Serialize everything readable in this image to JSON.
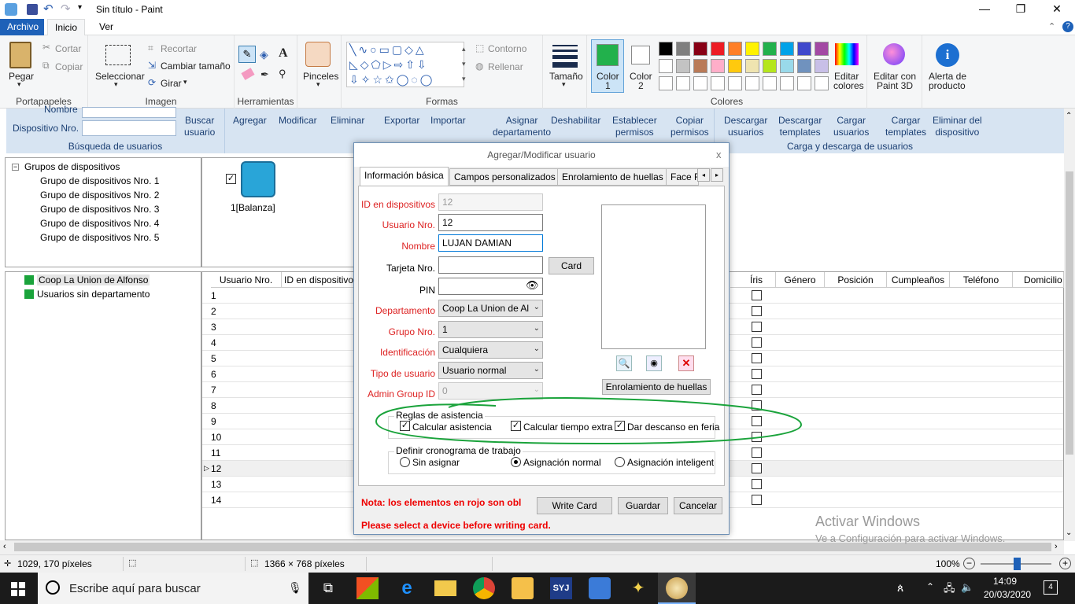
{
  "paint": {
    "title": "Sin título - Paint",
    "tabs": [
      "Archivo",
      "Inicio",
      "Ver"
    ],
    "clipboard": {
      "paste": "Pegar",
      "cut": "Cortar",
      "copy": "Copiar",
      "group": "Portapapeles"
    },
    "image": {
      "select": "Seleccionar",
      "crop": "Recortar",
      "resize": "Cambiar tamaño",
      "rotate": "Girar",
      "group": "Imagen"
    },
    "tools": {
      "group": "Herramientas"
    },
    "brushes": {
      "label": "Pinceles"
    },
    "shapes": {
      "outline": "Contorno",
      "fill": "Rellenar",
      "group": "Formas"
    },
    "size": {
      "label": "Tamaño"
    },
    "color1": {
      "label": "Color",
      "sub": "1"
    },
    "color2": {
      "label": "Color",
      "sub": "2"
    },
    "colors": {
      "group": "Colores",
      "edit": "Editar",
      "edit2": "colores"
    },
    "paint3d": {
      "l1": "Editar con",
      "l2": "Paint 3D"
    },
    "alert": {
      "l1": "Alerta de",
      "l2": "producto"
    },
    "palette_row1": [
      "#000000",
      "#7f7f7f",
      "#880015",
      "#ed1c24",
      "#ff7f27",
      "#fff200",
      "#22b14c",
      "#00a2e8",
      "#3f48cc",
      "#a349a4"
    ],
    "palette_row2": [
      "#ffffff",
      "#c3c3c3",
      "#b97a57",
      "#ffaec9",
      "#ffc90e",
      "#efe4b0",
      "#b5e61d",
      "#99d9ea",
      "#7092be",
      "#c8bfe7"
    ],
    "color1_value": "#22b14c"
  },
  "app": {
    "search": {
      "name_label": "Nombre",
      "device_label": "Dispositivo Nro.",
      "search_btn_l1": "Buscar",
      "search_btn_l2": "usuario",
      "caption": "Búsqueda de usuarios"
    },
    "buttons": [
      {
        "l1": "Agregar",
        "l2": ""
      },
      {
        "l1": "Modificar",
        "l2": ""
      },
      {
        "l1": "Eliminar",
        "l2": ""
      },
      {
        "l1": "Exportar",
        "l2": ""
      },
      {
        "l1": "Importar",
        "l2": ""
      },
      {
        "l1": "Asignar",
        "l2": "departamento"
      },
      {
        "l1": "Deshabilitar",
        "l2": ""
      },
      {
        "l1": "Establecer",
        "l2": "permisos"
      },
      {
        "l1": "Copiar",
        "l2": "permisos"
      }
    ],
    "downloads": [
      {
        "l1": "Descargar",
        "l2": "usuarios"
      },
      {
        "l1": "Descargar",
        "l2": "templates"
      },
      {
        "l1": "Cargar",
        "l2": "usuarios"
      },
      {
        "l1": "Cargar",
        "l2": "templates"
      },
      {
        "l1": "Eliminar del",
        "l2": "dispositivo"
      }
    ],
    "downloads_caption": "Carga y descarga de usuarios",
    "device_tree": {
      "root": "Grupos de dispositivos",
      "items": [
        "Grupo de dispositivos Nro. 1",
        "Grupo de dispositivos Nro. 2",
        "Grupo de dispositivos Nro. 3",
        "Grupo de dispositivos Nro. 4",
        "Grupo de dispositivos Nro. 5"
      ]
    },
    "device_icon_label": "1[Balanza]",
    "dept_tree": [
      "Coop La Union de Alfonso",
      "Usuarios sin departamento"
    ],
    "grid_headers_left": [
      "Usuario Nro.",
      "ID en dispositivo"
    ],
    "grid_headers_right": [
      "Íris",
      "Género",
      "Posición",
      "Cumpleaños",
      "Teléfono",
      "Domicilio"
    ],
    "rows": [
      "1",
      "2",
      "3",
      "4",
      "5",
      "6",
      "7",
      "8",
      "9",
      "10",
      "11",
      "12",
      "13",
      "14"
    ],
    "selected_row": "12"
  },
  "dialog": {
    "title": "Agregar/Modificar usuario",
    "close": "x",
    "tabs": [
      "Información básica",
      "Campos personalizados",
      "Enrolamiento de huellas",
      "Face F"
    ],
    "fields": {
      "device_id": {
        "label": "ID en dispositivos",
        "value": "12"
      },
      "user_no": {
        "label": "Usuario Nro.",
        "value": "12"
      },
      "name": {
        "label": "Nombre",
        "value": "LUJAN DAMIAN"
      },
      "card": {
        "label": "Tarjeta Nro.",
        "value": ""
      },
      "pin": {
        "label": "PIN",
        "value": ""
      },
      "department": {
        "label": "Departamento",
        "value": "Coop La Union de Al"
      },
      "group": {
        "label": "Grupo Nro.",
        "value": "1"
      },
      "identification": {
        "label": "Identificación",
        "value": "Cualquiera"
      },
      "user_type": {
        "label": "Tipo de usuario",
        "value": "Usuario normal"
      },
      "admin_group": {
        "label": "Admin Group ID",
        "value": "0"
      }
    },
    "card_button": "Card",
    "enroll_button": "Enrolamiento de huellas",
    "attendance": {
      "legend": "Reglas de asistencia",
      "calc": "Calcular asistencia",
      "extra": "Calcular tiempo extra",
      "rest": "Dar descanso en feria"
    },
    "schedule": {
      "legend": "Definir cronograma de trabajo",
      "none": "Sin asignar",
      "normal": "Asignación normal",
      "smart": "Asignación inteligent"
    },
    "note": "Nota: los elementos en rojo son obl",
    "warning": "Please select a device before writing card.",
    "write_card": "Write Card",
    "save": "Guardar",
    "cancel": "Cancelar"
  },
  "watermark": {
    "l1": "Activar Windows",
    "l2": "Ve a Configuración para activar Windows."
  },
  "status": {
    "coords": "1029, 170 píxeles",
    "size": "1366 × 768 píxeles",
    "zoom": "100%"
  },
  "taskbar": {
    "search": "Escribe aquí para buscar",
    "time": "14:09",
    "date": "20/03/2020",
    "notif": "4",
    "syj": "SYJ"
  }
}
